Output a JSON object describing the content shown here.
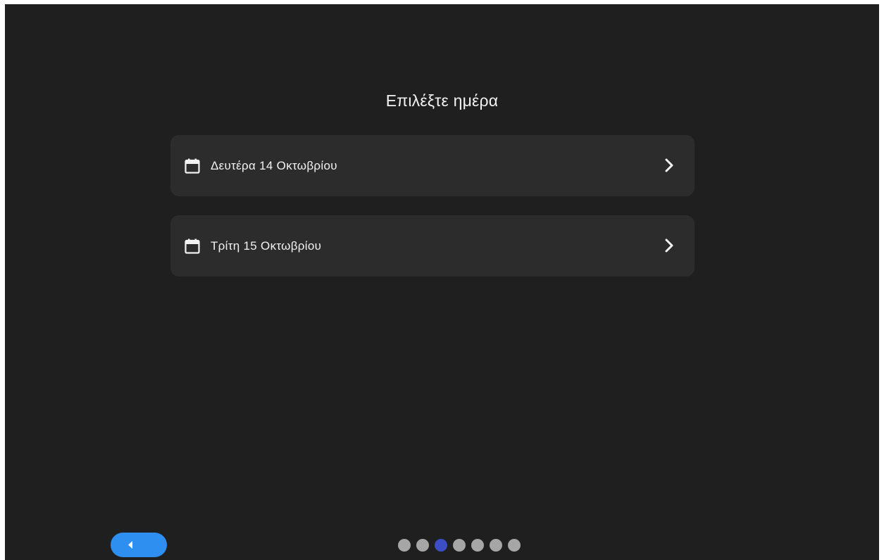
{
  "page": {
    "title": "Επιλέξτε ημέρα"
  },
  "days": [
    {
      "label": "Δευτέρα 14 Οκτωβρίου",
      "icon": "calendar-icon",
      "trailing_icon": "chevron-right-icon"
    },
    {
      "label": "Τρίτη 15 Οκτωβρίου",
      "icon": "calendar-icon",
      "trailing_icon": "chevron-right-icon"
    }
  ],
  "navigation": {
    "back_icon": "caret-left-icon",
    "step_count": 7,
    "active_step": 3
  },
  "colors": {
    "background": "#1f1f1f",
    "card": "#2c2c2c",
    "text": "#f2f2f2",
    "accent": "#2f8ff0",
    "dot_active": "#3c4ec4",
    "dot_inactive": "#a6a6a6"
  }
}
